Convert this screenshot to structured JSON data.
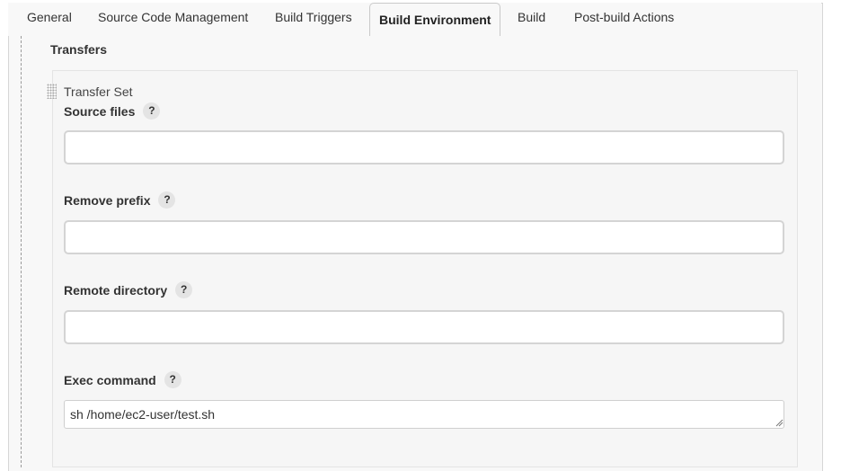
{
  "tabs": [
    {
      "label": "General",
      "active": false
    },
    {
      "label": "Source Code Management",
      "active": false
    },
    {
      "label": "Build Triggers",
      "active": false
    },
    {
      "label": "Build Environment",
      "active": true
    },
    {
      "label": "Build",
      "active": false
    },
    {
      "label": "Post-build Actions",
      "active": false
    }
  ],
  "section": {
    "title": "Transfers"
  },
  "transfer_set": {
    "label": "Transfer Set",
    "help_glyph": "?",
    "fields": {
      "source_files": {
        "label": "Source files",
        "value": ""
      },
      "remove_prefix": {
        "label": "Remove prefix",
        "value": ""
      },
      "remote_directory": {
        "label": "Remote directory",
        "value": ""
      },
      "exec_command": {
        "label": "Exec command",
        "value": "sh /home/ec2-user/test.sh"
      }
    }
  }
}
